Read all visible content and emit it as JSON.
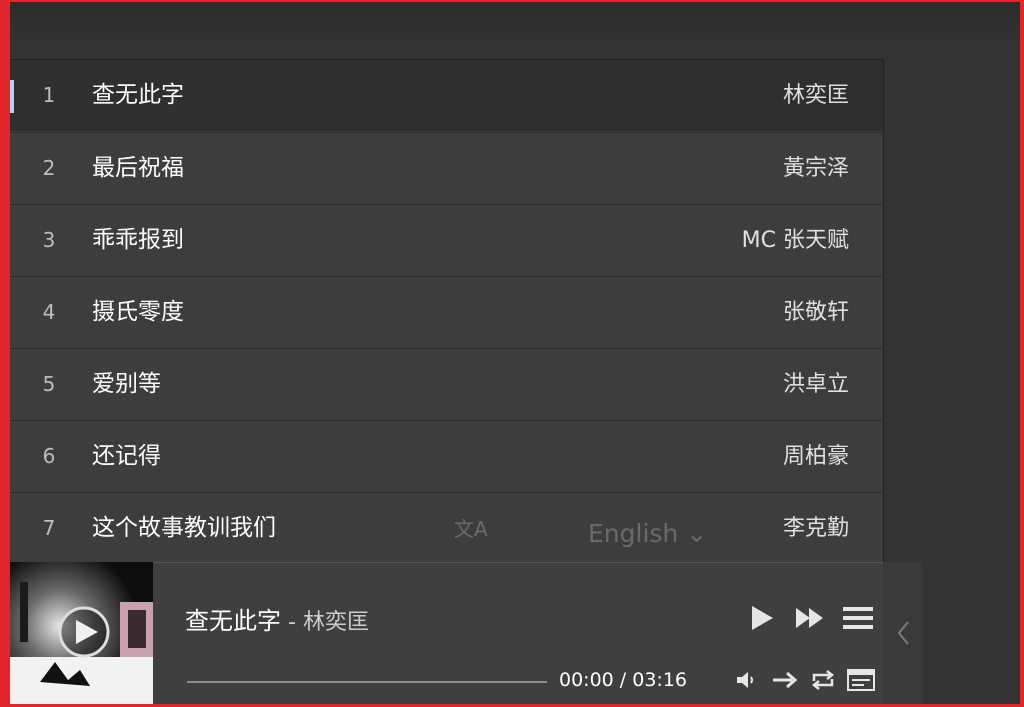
{
  "playlist": {
    "tracks": [
      {
        "num": "1",
        "title": "查无此字",
        "artist": "林奕匡"
      },
      {
        "num": "2",
        "title": "最后祝福",
        "artist": "黃宗泽"
      },
      {
        "num": "3",
        "title": "乖乖报到",
        "artist": "MC 张天赋"
      },
      {
        "num": "4",
        "title": "摄氏零度",
        "artist": "张敬轩"
      },
      {
        "num": "5",
        "title": "爱别等",
        "artist": "洪卓立"
      },
      {
        "num": "6",
        "title": "还记得",
        "artist": "周柏豪"
      },
      {
        "num": "7",
        "title": "这个故事教训我们",
        "artist": "李克勤"
      }
    ],
    "active_index": 0
  },
  "overlay": {
    "translate_glyph": "文A",
    "language": "English ⌄"
  },
  "player": {
    "title": "查无此字",
    "separator": " - ",
    "artist": "林奕匡",
    "time": "00:00 / 03:16",
    "progress": 0
  },
  "colors": {
    "background": "#333333",
    "list": "#3d3d3d",
    "active_row": "#2f2f2f",
    "indicator": "#b9d2ec",
    "border": "#e3242b"
  }
}
